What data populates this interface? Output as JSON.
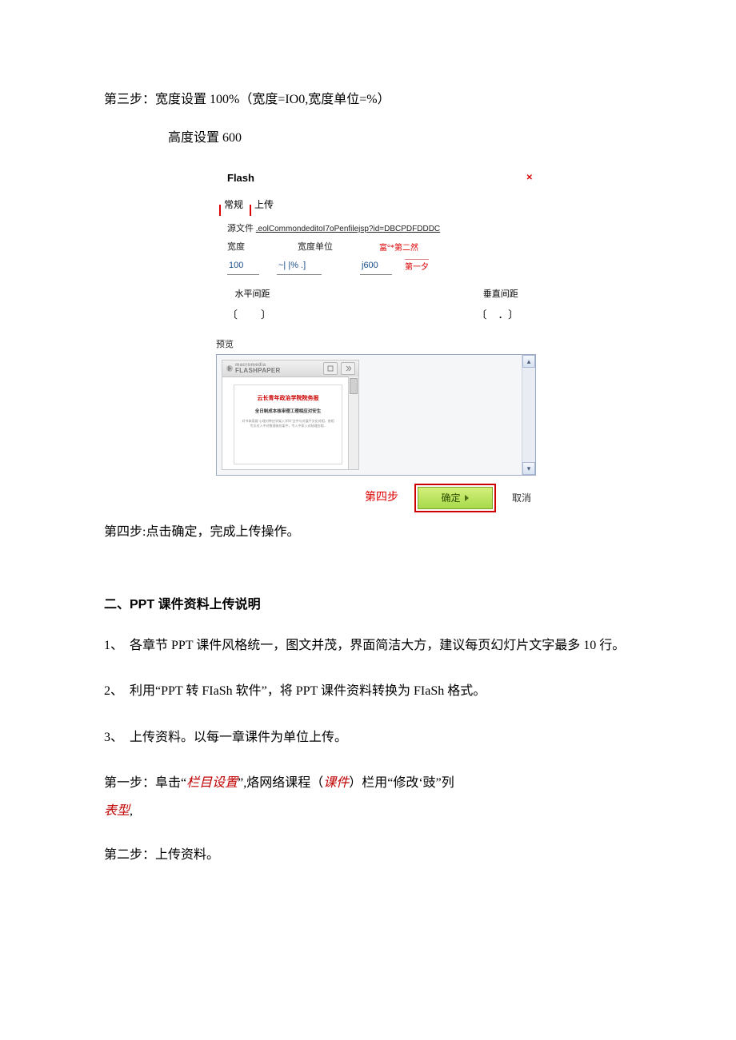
{
  "step3": {
    "line1": "第三步：宽度设置 100%（宽度=IO0,宽度单位=%）",
    "line2": "高度设置 600"
  },
  "dialog": {
    "title": "Flash",
    "tabs": {
      "general": "常规",
      "upload": "上传"
    },
    "src_label": "源文件",
    "src_value": ".eolCommondeditoI7oPenfilejsp?id=DBCPDFDDDC",
    "width_label": "宽度",
    "width_value": "100",
    "unit_label": "宽度单位",
    "unit_value": "~| |% .]",
    "height_label_note": "富°*第二然",
    "height_value": "j600",
    "step_note_right": "第一夕",
    "hspace_label": "水平间距",
    "vspace_label": "垂直间距",
    "preview_label": "预览",
    "flashpaper": {
      "brand_top": "macromedia",
      "brand_bottom": "FLASHPAPER",
      "doc_red": "云长青年政治学院院务报",
      "doc_blk": "全日制成本核审理工理相应对安生",
      "doc_grey": "对书体家展\"心理对种应学架入学科\"全中与对展平文化对相，各相专文对入中对数理体应架中，专入中家入对结理应相..."
    },
    "step4_label": "第四步",
    "ok_label": "确定",
    "cancel_label": "取消"
  },
  "step4_text": "第四步:点击确定，完成上传操作。",
  "section2_title": "二、PPT 课件资料上传说明",
  "items": [
    {
      "num": "1、",
      "text": "各章节 PPT 课件风格统一，图文并茂，界面简洁大方，建议每页幻灯片文字最多 10 行。"
    },
    {
      "num": "2、",
      "text": "利用“PPT 转 FIaSh 软件”，将 PPT 课件资料转换为 FIaSh 格式。"
    },
    {
      "num": "3、",
      "text": "上传资料。以每一章课件为单位上传。"
    }
  ],
  "step1": {
    "prefix": "第一步：阜击“",
    "red1": "栏目设置",
    "mid1": "”,烙网络课程（",
    "red2": "课件",
    "mid2": "）栏用“修改‘豉”列",
    "red3": "表型",
    "suffix": ","
  },
  "step2_text": "第二步：上传资料。"
}
